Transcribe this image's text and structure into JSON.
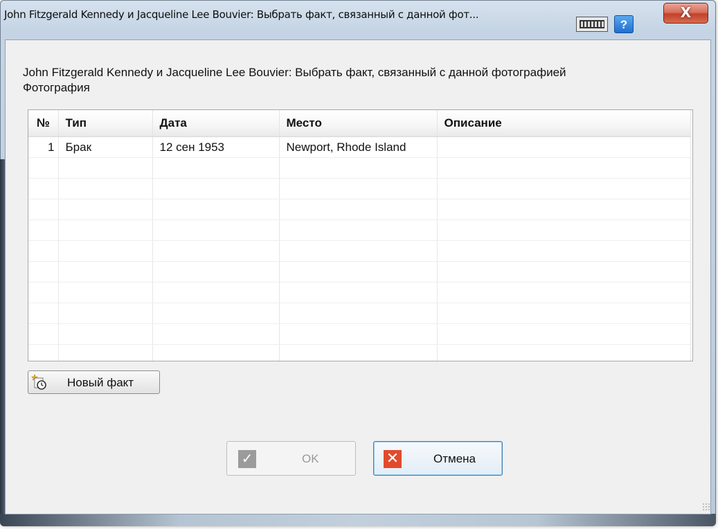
{
  "window": {
    "title": "John Fitzgerald Kennedy и Jacqueline Lee Bouvier: Выбрать факт, связанный с данной фот...",
    "close_glyph": "X",
    "help_glyph": "?"
  },
  "dialog": {
    "heading": "John Fitzgerald Kennedy и Jacqueline Lee Bouvier: Выбрать факт, связанный с данной фотографией",
    "subheading": "Фотография"
  },
  "table": {
    "columns": [
      "№",
      "Тип",
      "Дата",
      "Место",
      "Описание"
    ],
    "rows": [
      {
        "num": "1",
        "type": "Брак",
        "date": "12 сен 1953",
        "place": "Newport, Rhode Island",
        "description": ""
      }
    ]
  },
  "buttons": {
    "new_fact": "Новый факт",
    "ok": "OK",
    "ok_glyph": "✓",
    "cancel": "Отмена",
    "cancel_glyph": "✕"
  },
  "colors": {
    "title_bar": "#c4d4e4",
    "close_button": "#c2412b",
    "cancel_icon": "#e24a2c",
    "ok_icon_disabled": "#9b9b9b",
    "focus_border": "#3c7fb1"
  }
}
